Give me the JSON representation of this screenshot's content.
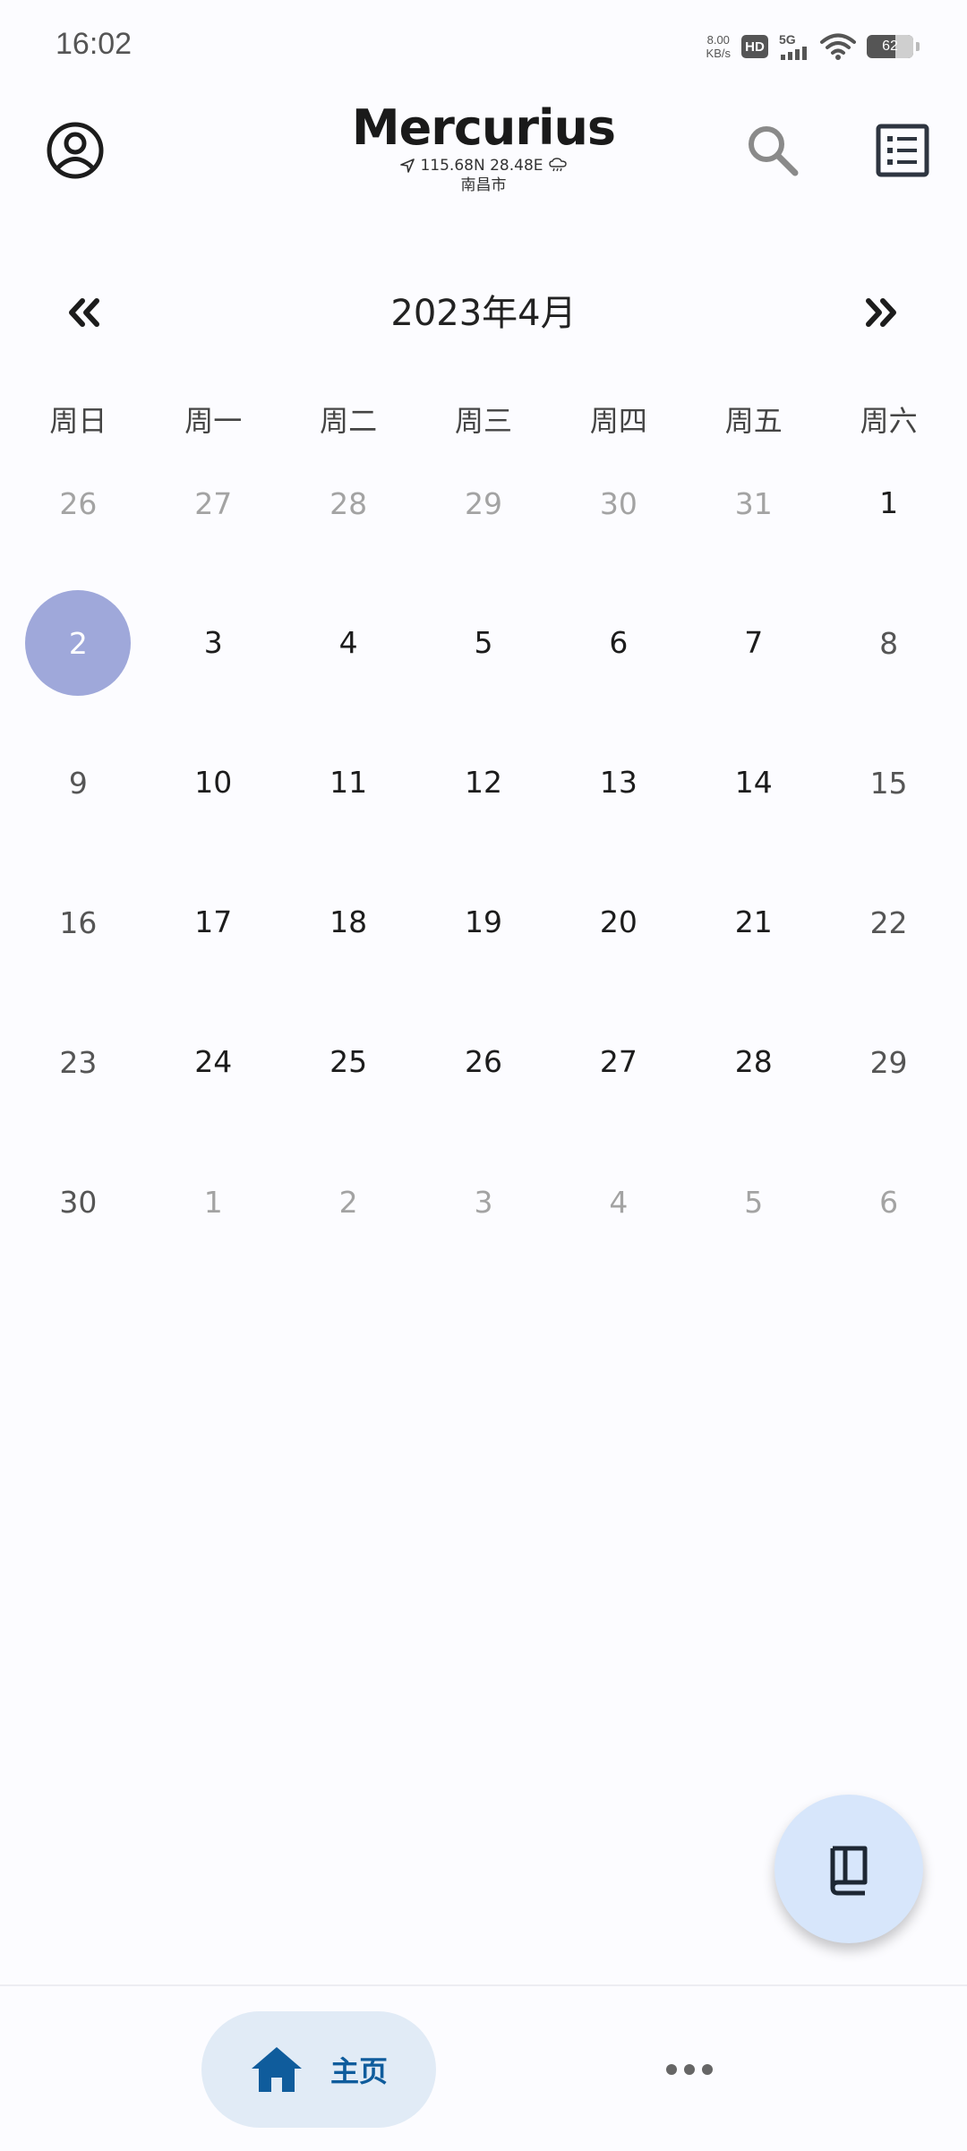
{
  "status_bar": {
    "time": "16:02",
    "net_speed_value": "8.00",
    "net_speed_unit": "KB/s",
    "hd_label": "HD",
    "network_label": "5G",
    "battery_level": "62"
  },
  "header": {
    "title": "Mercurius",
    "coordinates": "115.68N 28.48E",
    "city": "南昌市",
    "icons": {
      "profile": "account-circle-icon",
      "location": "navigation-arrow-icon",
      "weather": "cloud-rain-icon",
      "search": "search-icon",
      "list": "list-view-icon"
    }
  },
  "calendar": {
    "month_label": "2023年4月",
    "prev_icon": "double-chevron-left-icon",
    "next_icon": "double-chevron-right-icon",
    "weekdays": [
      "周日",
      "周一",
      "周二",
      "周三",
      "周四",
      "周五",
      "周六"
    ],
    "selected_color": "#9fa8da",
    "weeks": [
      [
        {
          "day": "26",
          "kind": "other"
        },
        {
          "day": "27",
          "kind": "other"
        },
        {
          "day": "28",
          "kind": "other"
        },
        {
          "day": "29",
          "kind": "other"
        },
        {
          "day": "30",
          "kind": "other"
        },
        {
          "day": "31",
          "kind": "other"
        },
        {
          "day": "1",
          "kind": "weekday"
        }
      ],
      [
        {
          "day": "2",
          "kind": "selected"
        },
        {
          "day": "3",
          "kind": "weekday"
        },
        {
          "day": "4",
          "kind": "weekday"
        },
        {
          "day": "5",
          "kind": "weekday"
        },
        {
          "day": "6",
          "kind": "weekday"
        },
        {
          "day": "7",
          "kind": "weekday"
        },
        {
          "day": "8",
          "kind": "weekend"
        }
      ],
      [
        {
          "day": "9",
          "kind": "weekend"
        },
        {
          "day": "10",
          "kind": "weekday"
        },
        {
          "day": "11",
          "kind": "weekday"
        },
        {
          "day": "12",
          "kind": "weekday"
        },
        {
          "day": "13",
          "kind": "weekday"
        },
        {
          "day": "14",
          "kind": "weekday"
        },
        {
          "day": "15",
          "kind": "weekend"
        }
      ],
      [
        {
          "day": "16",
          "kind": "weekend"
        },
        {
          "day": "17",
          "kind": "weekday"
        },
        {
          "day": "18",
          "kind": "weekday"
        },
        {
          "day": "19",
          "kind": "weekday"
        },
        {
          "day": "20",
          "kind": "weekday"
        },
        {
          "day": "21",
          "kind": "weekday"
        },
        {
          "day": "22",
          "kind": "weekend"
        }
      ],
      [
        {
          "day": "23",
          "kind": "weekend"
        },
        {
          "day": "24",
          "kind": "weekday"
        },
        {
          "day": "25",
          "kind": "weekday"
        },
        {
          "day": "26",
          "kind": "weekday"
        },
        {
          "day": "27",
          "kind": "weekday"
        },
        {
          "day": "28",
          "kind": "weekday"
        },
        {
          "day": "29",
          "kind": "weekend"
        }
      ],
      [
        {
          "day": "30",
          "kind": "weekend"
        },
        {
          "day": "1",
          "kind": "other"
        },
        {
          "day": "2",
          "kind": "other"
        },
        {
          "day": "3",
          "kind": "other"
        },
        {
          "day": "4",
          "kind": "other"
        },
        {
          "day": "5",
          "kind": "other"
        },
        {
          "day": "6",
          "kind": "other"
        }
      ]
    ]
  },
  "fab": {
    "icon": "book-icon",
    "color": "#d7e6fb"
  },
  "bottom_nav": {
    "home_label": "主页",
    "home_icon": "home-icon",
    "more_icon": "more-horizontal-icon",
    "active_color": "#0f5c9c"
  }
}
